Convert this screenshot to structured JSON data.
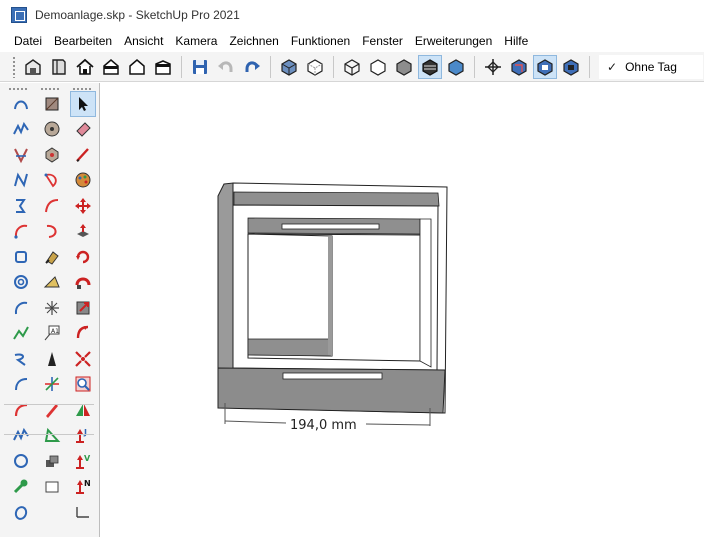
{
  "window": {
    "title": "Demoanlage.skp - SketchUp Pro 2021"
  },
  "menu": [
    {
      "label": "Datei"
    },
    {
      "label": "Bearbeiten"
    },
    {
      "label": "Ansicht"
    },
    {
      "label": "Kamera"
    },
    {
      "label": "Zeichnen"
    },
    {
      "label": "Funktionen"
    },
    {
      "label": "Fenster"
    },
    {
      "label": "Erweiterungen"
    },
    {
      "label": "Hilfe"
    }
  ],
  "toolbar": {
    "groups": [
      [
        "warehouse-icon",
        "extension-book-icon",
        "home-view-icon",
        "front-view-icon",
        "back-view-icon",
        "side-view-icon"
      ],
      [
        "save-icon",
        "undo-icon",
        "redo-icon"
      ],
      [
        "xray-icon",
        "back-edges-icon"
      ],
      [
        "wireframe-icon",
        "hidden-line-icon",
        "shaded-icon",
        "shaded-textures-icon",
        "monochrome-icon"
      ],
      [
        "section-plane-icon",
        "display-section-planes-icon",
        "display-section-cuts-icon",
        "display-section-fill-icon"
      ]
    ],
    "active_icons": [
      "shaded-textures-icon",
      "display-section-cuts-icon"
    ],
    "tag": {
      "check": "✓",
      "label": "Ohne Tag"
    }
  },
  "palette": {
    "active_tool": "select-tool-icon"
  },
  "model": {
    "dimension_label": "194,0 mm"
  },
  "colors": {
    "accent": "#cde3f7",
    "canvas": "#ffffff",
    "model_shade": "#8c8c8c"
  }
}
